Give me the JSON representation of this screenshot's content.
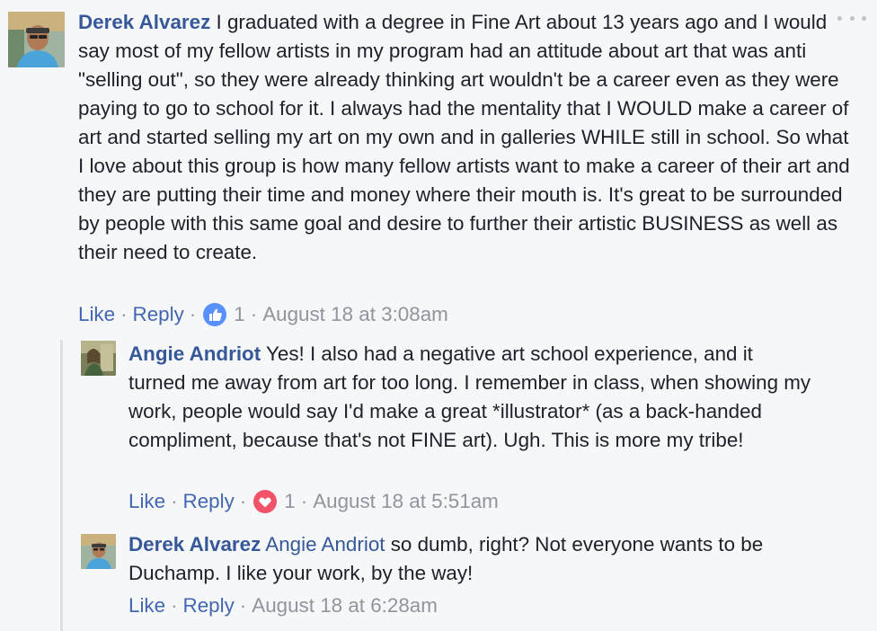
{
  "comments": [
    {
      "author": "Derek Alvarez",
      "text": "I graduated with a degree in Fine Art about 13 years ago and I would say most of my fellow artists in my program had an attitude about art that was anti \"selling out\", so they were already thinking art wouldn't be a career even as they were paying to go to school for it. I always had the mentality that I WOULD make a career of art and started selling my art on my own and in galleries WHILE still in school. So what I love about this group is how many fellow artists want to make a career of their art and they are putting their time and money where their mouth is. It's great to be surrounded by people with this same goal and desire to further their artistic BUSINESS as well as their need to create.",
      "like_label": "Like",
      "reply_label": "Reply",
      "reaction": "like",
      "reaction_count": "1",
      "timestamp": "August 18 at 3:08am"
    }
  ],
  "replies": [
    {
      "author": "Angie Andriot",
      "text": "Yes! I also had a negative art school experience, and it turned me away from art for too long. I remember in class, when showing my work, people would say I'd make a great *illustrator* (as a back-handed compliment, because that's not FINE art). Ugh. This is more my tribe!",
      "like_label": "Like",
      "reply_label": "Reply",
      "reaction": "love",
      "reaction_count": "1",
      "timestamp": "August 18 at 5:51am"
    },
    {
      "author": "Derek Alvarez",
      "mention": "Angie Andriot",
      "text": "so dumb, right? Not everyone wants to be Duchamp. I like your work, by the way!",
      "like_label": "Like",
      "reply_label": "Reply",
      "timestamp": "August 18 at 6:28am"
    }
  ],
  "separators": {
    "dot": "·"
  },
  "colors": {
    "author": "#365899",
    "link": "#4267b2",
    "meta": "#90949c",
    "like_reaction": "#5890ff",
    "love_reaction": "#f25268"
  },
  "icons": {
    "more": "more-options-icon",
    "like": "thumbs-up-reaction-icon",
    "love": "heart-reaction-icon"
  }
}
